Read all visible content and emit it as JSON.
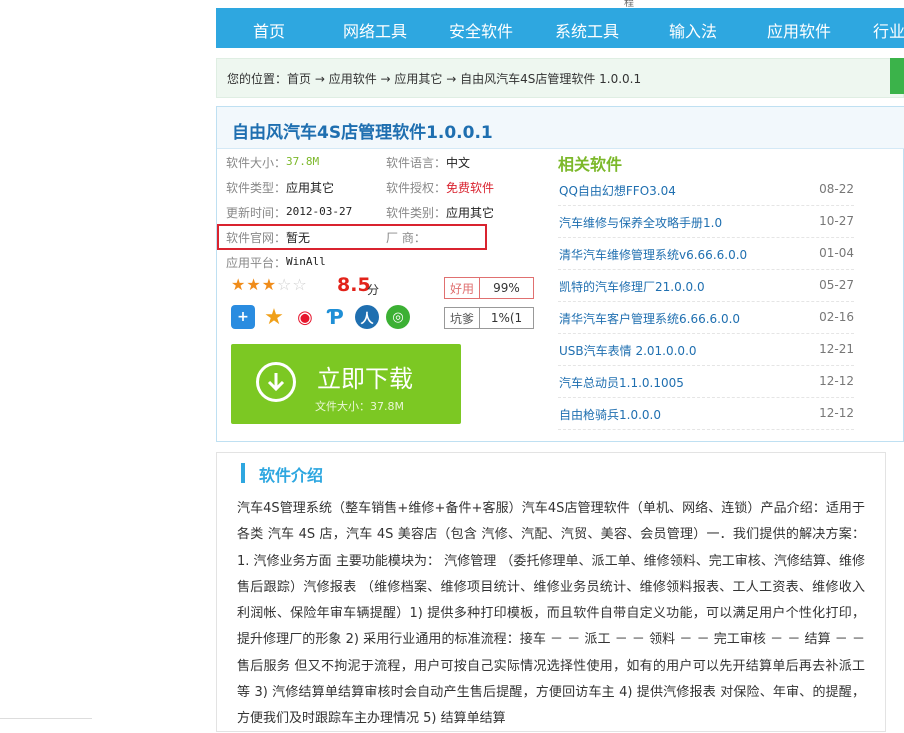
{
  "header_fragment": "程",
  "nav": {
    "items": [
      "首页",
      "网络工具",
      "安全软件",
      "系统工具",
      "输入法",
      "应用软件",
      "行业"
    ]
  },
  "breadcrumb": {
    "prefix": "您的位置：",
    "path": "首页 → 应用软件 → 应用其它 → 自由风汽车4S店管理软件 1.0.0.1"
  },
  "software": {
    "title": "自由风汽车4S店管理软件1.0.0.1",
    "fields": {
      "size_label": "软件大小：",
      "size_value": "37.8M",
      "lang_label": "软件语言：",
      "lang_value": "中文",
      "type_label": "软件类型：",
      "type_value": "应用其它",
      "license_label": "软件授权：",
      "license_value": "免费软件",
      "update_label": "更新时间：",
      "update_value": "2012-03-27",
      "category_label": "软件类别：",
      "category_value": "应用其它",
      "site_label": "软件官网：",
      "site_value": "暂无",
      "vendor_label": "厂    商：",
      "vendor_value": "",
      "platform_label": "应用平台：",
      "platform_value": "WinAll"
    },
    "rating": {
      "stars": 3,
      "max_stars": 5,
      "score": "8.5",
      "unit": "分"
    },
    "votes": [
      {
        "label": "好用",
        "value": "99%"
      },
      {
        "label": "坑爹",
        "value": "1%(1"
      }
    ],
    "share_icons": [
      "plus-share-icon",
      "qzone-star-icon",
      "weibo-icon",
      "pinterest-p-icon",
      "renren-icon",
      "wechat-icon"
    ],
    "download": {
      "label": "立即下载",
      "size_text": "文件大小：37.8M"
    }
  },
  "related": {
    "title": "相关软件",
    "items": [
      {
        "name": "QQ自由幻想FFO3.04",
        "date": "08-22"
      },
      {
        "name": "汽车维修与保养全攻略手册1.0",
        "date": "10-27"
      },
      {
        "name": "清华汽车维修管理系统v6.66.6.0.0",
        "date": "01-04"
      },
      {
        "name": "凯特的汽车修理厂21.0.0.0",
        "date": "05-27"
      },
      {
        "name": "清华汽车客户管理系统6.66.6.0.0",
        "date": "02-16"
      },
      {
        "name": "USB汽车表情 2.01.0.0.0",
        "date": "12-21"
      },
      {
        "name": "汽车总动员1.1.0.1005",
        "date": "12-12"
      },
      {
        "name": "自由枪骑兵1.0.0.0",
        "date": "12-12"
      }
    ]
  },
  "intro": {
    "title": "软件介绍",
    "text": "汽车4S管理系统（整车销售+维修+备件+客服）汽车4S店管理软件（单机、网络、连锁）产品介绍：适用于各类 汽车 4S 店，汽车 4S 美容店（包含 汽修、汽配、汽贸、美容、会员管理）一．我们提供的解决方案： 1. 汽修业务方面 主要功能模块为： 汽修管理 （委托修理单、派工单、维修领料、完工审核、汽修结算、维修售后跟踪）汽修报表 （维修档案、维修项目统计、维修业务员统计、维修领料报表、工人工资表、维修收入利润帐、保险年审车辆提醒）1) 提供多种打印模板，而且软件自带自定义功能，可以满足用户个性化打印，提升修理厂的形象 2) 采用行业通用的标准流程：接车 － － 派工 － － 领料 － － 完工审核 － － 结算 － － 售后服务 但又不拘泥于流程，用户可按自己实际情况选择性使用，如有的用户可以先开结算单后再去补派工等 3) 汽修结算单结算审核时会自动产生售后提醒，方便回访车主 4) 提供汽修报表 对保险、年审、的提醒，方便我们及时跟踪车主办理情况 5) 结算单结算"
  },
  "colors": {
    "nav_bg": "#2ea7e0",
    "title_blue": "#1f6fb0",
    "green_button": "#7cc823",
    "related_green": "#7cb82a",
    "license_red": "#d9232f",
    "star_orange": "#f08c1a"
  }
}
